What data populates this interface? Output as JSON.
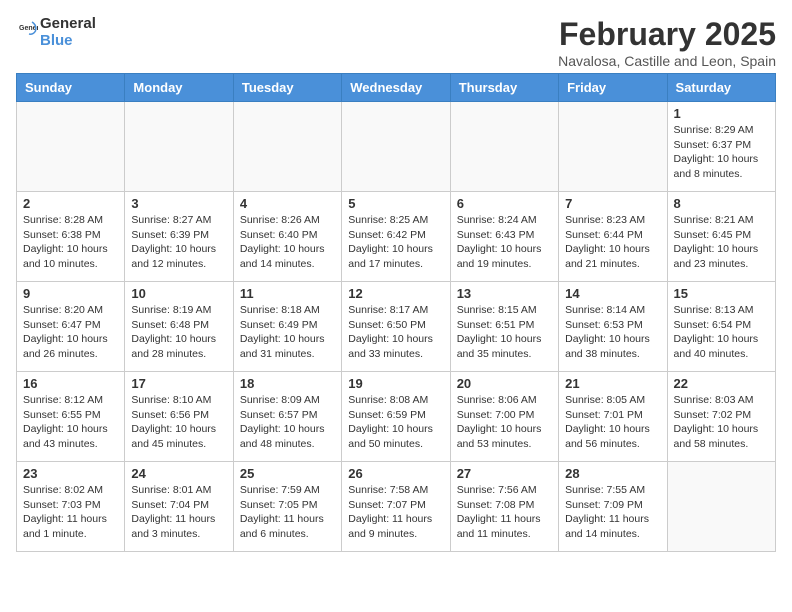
{
  "app": {
    "logo_general": "General",
    "logo_blue": "Blue",
    "month_title": "February 2025",
    "subtitle": "Navalosa, Castille and Leon, Spain"
  },
  "calendar": {
    "headers": [
      "Sunday",
      "Monday",
      "Tuesday",
      "Wednesday",
      "Thursday",
      "Friday",
      "Saturday"
    ],
    "weeks": [
      [
        {
          "day": "",
          "info": ""
        },
        {
          "day": "",
          "info": ""
        },
        {
          "day": "",
          "info": ""
        },
        {
          "day": "",
          "info": ""
        },
        {
          "day": "",
          "info": ""
        },
        {
          "day": "",
          "info": ""
        },
        {
          "day": "1",
          "info": "Sunrise: 8:29 AM\nSunset: 6:37 PM\nDaylight: 10 hours and 8 minutes."
        }
      ],
      [
        {
          "day": "2",
          "info": "Sunrise: 8:28 AM\nSunset: 6:38 PM\nDaylight: 10 hours and 10 minutes."
        },
        {
          "day": "3",
          "info": "Sunrise: 8:27 AM\nSunset: 6:39 PM\nDaylight: 10 hours and 12 minutes."
        },
        {
          "day": "4",
          "info": "Sunrise: 8:26 AM\nSunset: 6:40 PM\nDaylight: 10 hours and 14 minutes."
        },
        {
          "day": "5",
          "info": "Sunrise: 8:25 AM\nSunset: 6:42 PM\nDaylight: 10 hours and 17 minutes."
        },
        {
          "day": "6",
          "info": "Sunrise: 8:24 AM\nSunset: 6:43 PM\nDaylight: 10 hours and 19 minutes."
        },
        {
          "day": "7",
          "info": "Sunrise: 8:23 AM\nSunset: 6:44 PM\nDaylight: 10 hours and 21 minutes."
        },
        {
          "day": "8",
          "info": "Sunrise: 8:21 AM\nSunset: 6:45 PM\nDaylight: 10 hours and 23 minutes."
        }
      ],
      [
        {
          "day": "9",
          "info": "Sunrise: 8:20 AM\nSunset: 6:47 PM\nDaylight: 10 hours and 26 minutes."
        },
        {
          "day": "10",
          "info": "Sunrise: 8:19 AM\nSunset: 6:48 PM\nDaylight: 10 hours and 28 minutes."
        },
        {
          "day": "11",
          "info": "Sunrise: 8:18 AM\nSunset: 6:49 PM\nDaylight: 10 hours and 31 minutes."
        },
        {
          "day": "12",
          "info": "Sunrise: 8:17 AM\nSunset: 6:50 PM\nDaylight: 10 hours and 33 minutes."
        },
        {
          "day": "13",
          "info": "Sunrise: 8:15 AM\nSunset: 6:51 PM\nDaylight: 10 hours and 35 minutes."
        },
        {
          "day": "14",
          "info": "Sunrise: 8:14 AM\nSunset: 6:53 PM\nDaylight: 10 hours and 38 minutes."
        },
        {
          "day": "15",
          "info": "Sunrise: 8:13 AM\nSunset: 6:54 PM\nDaylight: 10 hours and 40 minutes."
        }
      ],
      [
        {
          "day": "16",
          "info": "Sunrise: 8:12 AM\nSunset: 6:55 PM\nDaylight: 10 hours and 43 minutes."
        },
        {
          "day": "17",
          "info": "Sunrise: 8:10 AM\nSunset: 6:56 PM\nDaylight: 10 hours and 45 minutes."
        },
        {
          "day": "18",
          "info": "Sunrise: 8:09 AM\nSunset: 6:57 PM\nDaylight: 10 hours and 48 minutes."
        },
        {
          "day": "19",
          "info": "Sunrise: 8:08 AM\nSunset: 6:59 PM\nDaylight: 10 hours and 50 minutes."
        },
        {
          "day": "20",
          "info": "Sunrise: 8:06 AM\nSunset: 7:00 PM\nDaylight: 10 hours and 53 minutes."
        },
        {
          "day": "21",
          "info": "Sunrise: 8:05 AM\nSunset: 7:01 PM\nDaylight: 10 hours and 56 minutes."
        },
        {
          "day": "22",
          "info": "Sunrise: 8:03 AM\nSunset: 7:02 PM\nDaylight: 10 hours and 58 minutes."
        }
      ],
      [
        {
          "day": "23",
          "info": "Sunrise: 8:02 AM\nSunset: 7:03 PM\nDaylight: 11 hours and 1 minute."
        },
        {
          "day": "24",
          "info": "Sunrise: 8:01 AM\nSunset: 7:04 PM\nDaylight: 11 hours and 3 minutes."
        },
        {
          "day": "25",
          "info": "Sunrise: 7:59 AM\nSunset: 7:05 PM\nDaylight: 11 hours and 6 minutes."
        },
        {
          "day": "26",
          "info": "Sunrise: 7:58 AM\nSunset: 7:07 PM\nDaylight: 11 hours and 9 minutes."
        },
        {
          "day": "27",
          "info": "Sunrise: 7:56 AM\nSunset: 7:08 PM\nDaylight: 11 hours and 11 minutes."
        },
        {
          "day": "28",
          "info": "Sunrise: 7:55 AM\nSunset: 7:09 PM\nDaylight: 11 hours and 14 minutes."
        },
        {
          "day": "",
          "info": ""
        }
      ]
    ]
  }
}
